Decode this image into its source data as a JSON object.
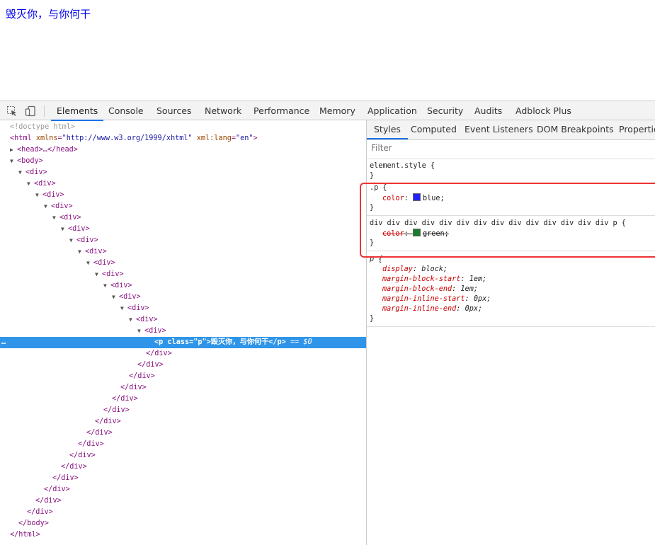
{
  "page": {
    "text": "毁灭你，与你何干"
  },
  "devtools": {
    "tabs": [
      {
        "label": "Elements"
      },
      {
        "label": "Console"
      },
      {
        "label": "Sources"
      },
      {
        "label": "Network"
      },
      {
        "label": "Performance"
      },
      {
        "label": "Memory"
      },
      {
        "label": "Application"
      },
      {
        "label": "Security"
      },
      {
        "label": "Audits"
      },
      {
        "label": "Adblock Plus"
      }
    ],
    "icons": [
      "inspect-element-icon",
      "device-toolbar-icon"
    ],
    "active_tab": "Elements"
  },
  "elements": {
    "doctype": "<!doctype html>",
    "html_open_tag": "<html",
    "html_attr1_name": "xmlns",
    "html_attr1_val": "\"http://www.w3.org/1999/xhtml\"",
    "html_attr2_name": "xml:lang",
    "html_attr2_val": "\"en\"",
    "head": "<head>…</head>",
    "body_open": "<body>",
    "div_open": "<div>",
    "div_close": "</div>",
    "body_close": "</body>",
    "html_close": "</html>",
    "selected": {
      "dots": "…",
      "tag_open": "<p",
      "attr_name": "class",
      "attr_val": "\"p\"",
      "text": ">毁灭你，与你何干</p>",
      "marker": "== $0"
    }
  },
  "styles": {
    "subtabs": [
      {
        "label": "Styles"
      },
      {
        "label": "Computed"
      },
      {
        "label": "Event Listeners"
      },
      {
        "label": "DOM Breakpoints"
      },
      {
        "label": "Properties"
      }
    ],
    "filter_placeholder": "Filter",
    "rules": [
      {
        "selector": "element.style {",
        "close": "}"
      },
      {
        "selector": ".p {",
        "prop": "color",
        "value": "blue;",
        "swatch": "#2222ff",
        "close": "}"
      },
      {
        "selector": "div div div div div div div div div div div div div div p {",
        "prop": "color",
        "value": "green;",
        "swatch": "#1a7a2a",
        "close": "}"
      },
      {
        "selector": "p {",
        "props": [
          {
            "name": "display",
            "value": "block;"
          },
          {
            "name": "margin-block-start",
            "value": "1em;"
          },
          {
            "name": "margin-block-end",
            "value": "1em;"
          },
          {
            "name": "margin-inline-start",
            "value": "0px;"
          },
          {
            "name": "margin-inline-end",
            "value": "0px;"
          }
        ],
        "close": "}"
      }
    ]
  },
  "colors": {
    "accent": "#1a73e8",
    "selection": "#2f95e8",
    "highlight_box": "#ee3333"
  }
}
